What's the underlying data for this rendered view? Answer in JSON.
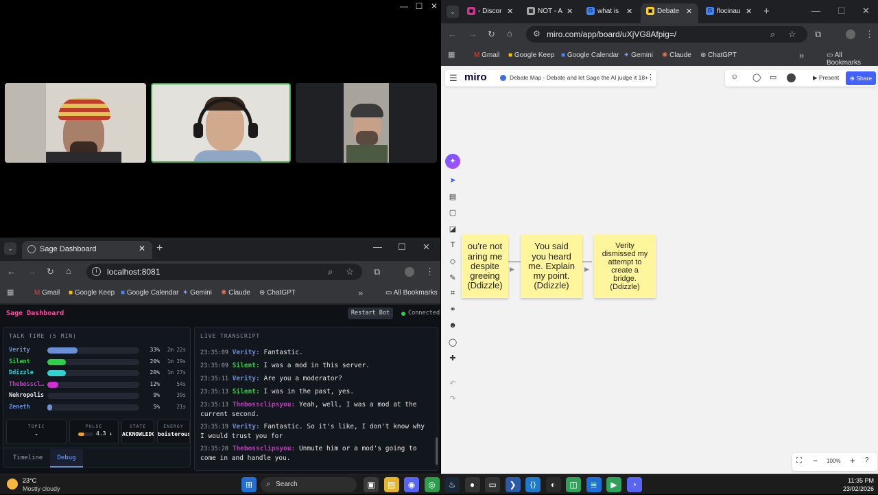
{
  "call": {
    "min": "—",
    "max": "☐",
    "close": "✕"
  },
  "sage_browser": {
    "tab_title": "Sage Dashboard",
    "url": "localhost:8081",
    "bookmarks": [
      "Gmail",
      "Google Keep",
      "Google Calendar",
      "Gemini",
      "Claude",
      "ChatGPT"
    ],
    "all_bookmarks": "All Bookmarks"
  },
  "dashboard": {
    "title": "Sage Dashboard",
    "restart_label": "Restart Bot",
    "status": "Connected",
    "talk_time_title": "TALK TIME",
    "talk_time_window": "(5 MIN)",
    "speakers": [
      {
        "name": "Verity",
        "pct": "33%",
        "time": "2m 22s",
        "fraction": 0.33,
        "color": "#6b8fd6"
      },
      {
        "name": "Silent",
        "pct": "20%",
        "time": "1m 29s",
        "fraction": 0.2,
        "color": "#2fd04a"
      },
      {
        "name": "Ddizzle",
        "pct": "20%",
        "time": "1m 27s",
        "fraction": 0.2,
        "color": "#2fd4d4"
      },
      {
        "name": "Thebosscl…",
        "pct": "12%",
        "time": "54s",
        "fraction": 0.12,
        "color": "#d02fd0"
      },
      {
        "name": "Nekropolis",
        "pct": "9%",
        "time": "39s",
        "fraction": 0.0,
        "color": "#e6e6e6"
      },
      {
        "name": "Zeneth",
        "pct": "5%",
        "time": "21s",
        "fraction": 0.05,
        "color": "#6b8fd6"
      }
    ],
    "stats": [
      {
        "label": "TOPIC",
        "value": "-"
      },
      {
        "label": "PULSE",
        "value": "4.3 ↓"
      },
      {
        "label": "STATE",
        "value": "ACKNOWLEDGE"
      },
      {
        "label": "ENERGY",
        "value": "boisterous"
      }
    ],
    "pulse_fraction": 0.43,
    "tabs": [
      "Timeline",
      "Debug"
    ],
    "transcript_title": "LIVE TRANSCRIPT",
    "transcript": [
      {
        "time": "23:35:09",
        "speaker": "Verity:",
        "color": "#6b8fd6",
        "text": "Fantastic."
      },
      {
        "time": "23:35:09",
        "speaker": "Silent:",
        "color": "#2fd04a",
        "text": "I was a mod in this server."
      },
      {
        "time": "23:35:11",
        "speaker": "Verity:",
        "color": "#6b8fd6",
        "text": "Are you a moderator?"
      },
      {
        "time": "23:35:13",
        "speaker": "Silent:",
        "color": "#2fd04a",
        "text": "I was in the past, yes."
      },
      {
        "time": "23:35:13",
        "speaker": "Thebossclipsyou:",
        "color": "#d02fd0",
        "text": "Yeah, well, I was a mod at the current second."
      },
      {
        "time": "23:35:19",
        "speaker": "Verity:",
        "color": "#6b8fd6",
        "text": "Fantastic. So it's like, I don't know why I would trust you for"
      },
      {
        "time": "23:35:20",
        "speaker": "Thebossclipsyou:",
        "color": "#d02fd0",
        "text": "Unmute him or a mod's going to come in and handle you."
      }
    ]
  },
  "miro_browser": {
    "tabs": [
      "- Discor",
      "NOT - A",
      "what is",
      "Debate",
      "flocinau"
    ],
    "url": "miro.com/app/board/uXjVG8Afpig=/",
    "bookmarks": [
      "Gmail",
      "Google Keep",
      "Google Calendar",
      "Gemini",
      "Claude",
      "ChatGPT"
    ],
    "all_bookmarks": "All Bookmarks",
    "logo": "miro",
    "board_title": "Debate Map - Debate and let Sage the AI judge it 18+",
    "present": "Present",
    "share": "Share",
    "zoom": "100%",
    "stickies": [
      {
        "text": "ou're not\naring me\ndespite\ngreeing",
        "author": "(Ddizzle)"
      },
      {
        "text": "You said\nyou heard\nme. Explain\nmy point.",
        "author": "(Ddizzle)"
      },
      {
        "text": "Verity\ndismissed my\nattempt to\ncreate a\nbridge.",
        "author": "(Ddizzle)"
      }
    ]
  },
  "taskbar": {
    "weather_temp": "23°C",
    "weather_desc": "Mostly cloudy",
    "search": "Search",
    "time": "11:35 PM",
    "date": "23/02/2026"
  }
}
